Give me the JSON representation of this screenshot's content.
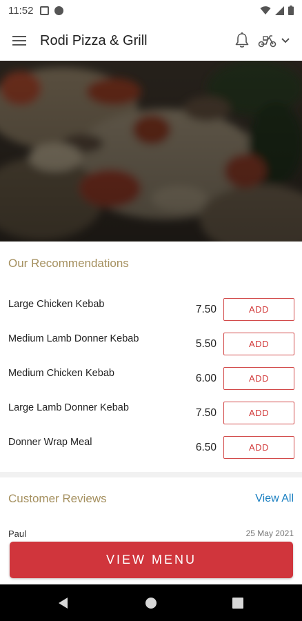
{
  "status_bar": {
    "time": "11:52"
  },
  "app_bar": {
    "title": "Rodi Pizza & Grill"
  },
  "recommendations": {
    "title": "Our Recommendations",
    "items": [
      {
        "name": "Large Chicken Kebab",
        "price": "7.50",
        "action": "ADD"
      },
      {
        "name": "Medium Lamb Donner Kebab",
        "price": "5.50",
        "action": "ADD"
      },
      {
        "name": "Medium Chicken Kebab",
        "price": "6.00",
        "action": "ADD"
      },
      {
        "name": "Large Lamb Donner Kebab",
        "price": "7.50",
        "action": "ADD"
      },
      {
        "name": "Donner Wrap Meal",
        "price": "6.50",
        "action": "ADD"
      }
    ]
  },
  "reviews": {
    "title": "Customer Reviews",
    "view_all": "View All",
    "first_review": {
      "author": "Paul",
      "date": "25 May 2021"
    }
  },
  "cta": {
    "label": "VIEW MENU"
  },
  "colors": {
    "accent_gold": "#a5905f",
    "brand_red": "#d0353c",
    "link_blue": "#1a7fc1"
  },
  "icons": {
    "menu": "hamburger-icon",
    "notifications": "bell-icon",
    "delivery": "scooter-icon",
    "dropdown": "chevron-down-icon"
  }
}
